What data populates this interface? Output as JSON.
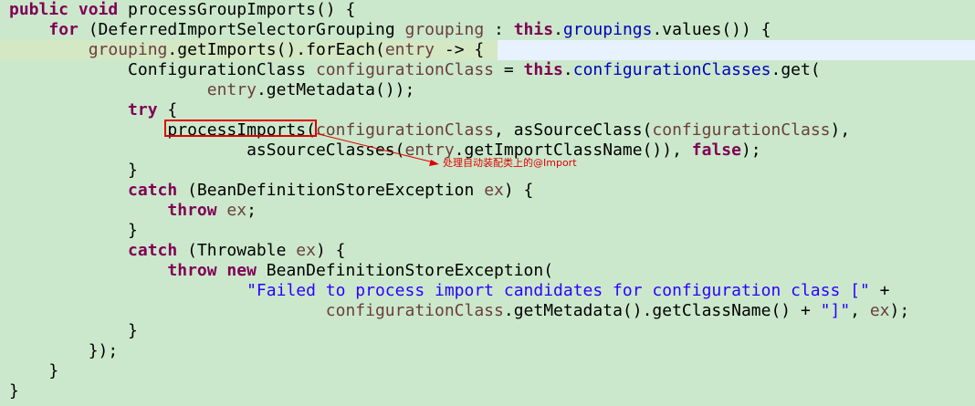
{
  "editor": {
    "lines": [
      [
        {
          "t": "public void",
          "c": "kw"
        },
        {
          "t": " processGroupImports() {",
          "c": "plain"
        }
      ],
      [
        {
          "t": "    ",
          "c": "plain"
        },
        {
          "t": "for",
          "c": "kw"
        },
        {
          "t": " (DeferredImportSelectorGrouping ",
          "c": "plain"
        },
        {
          "t": "grouping",
          "c": "var"
        },
        {
          "t": " : ",
          "c": "plain"
        },
        {
          "t": "this",
          "c": "kw"
        },
        {
          "t": ".",
          "c": "plain"
        },
        {
          "t": "groupings",
          "c": "fld"
        },
        {
          "t": ".values()) {",
          "c": "plain"
        }
      ],
      [
        {
          "t": "        ",
          "c": "plain"
        },
        {
          "t": "grouping",
          "c": "var"
        },
        {
          "t": ".getImports().forEach(",
          "c": "plain"
        },
        {
          "t": "entry",
          "c": "var"
        },
        {
          "t": " -> {",
          "c": "plain"
        }
      ],
      [
        {
          "t": "            ConfigurationClass ",
          "c": "plain"
        },
        {
          "t": "configurationClass",
          "c": "var"
        },
        {
          "t": " = ",
          "c": "plain"
        },
        {
          "t": "this",
          "c": "kw"
        },
        {
          "t": ".",
          "c": "plain"
        },
        {
          "t": "configurationClasses",
          "c": "fld"
        },
        {
          "t": ".get(",
          "c": "plain"
        }
      ],
      [
        {
          "t": "                    ",
          "c": "plain"
        },
        {
          "t": "entry",
          "c": "var"
        },
        {
          "t": ".getMetadata());",
          "c": "plain"
        }
      ],
      [
        {
          "t": "            ",
          "c": "plain"
        },
        {
          "t": "try",
          "c": "kw"
        },
        {
          "t": " {",
          "c": "plain"
        }
      ],
      [
        {
          "t": "                processImports(",
          "c": "plain"
        },
        {
          "t": "configurationClass",
          "c": "var"
        },
        {
          "t": ", asSourceClass(",
          "c": "plain"
        },
        {
          "t": "configurationClass",
          "c": "var"
        },
        {
          "t": "),",
          "c": "plain"
        }
      ],
      [
        {
          "t": "                        asSourceClasses(",
          "c": "plain"
        },
        {
          "t": "entry",
          "c": "var"
        },
        {
          "t": ".getImportClassName()), ",
          "c": "plain"
        },
        {
          "t": "false",
          "c": "kw"
        },
        {
          "t": ");",
          "c": "plain"
        }
      ],
      [
        {
          "t": "            }",
          "c": "plain"
        }
      ],
      [
        {
          "t": "            ",
          "c": "plain"
        },
        {
          "t": "catch",
          "c": "kw"
        },
        {
          "t": " (BeanDefinitionStoreException ",
          "c": "plain"
        },
        {
          "t": "ex",
          "c": "var"
        },
        {
          "t": ") {",
          "c": "plain"
        }
      ],
      [
        {
          "t": "                ",
          "c": "plain"
        },
        {
          "t": "throw",
          "c": "kw"
        },
        {
          "t": " ",
          "c": "plain"
        },
        {
          "t": "ex",
          "c": "var"
        },
        {
          "t": ";",
          "c": "plain"
        }
      ],
      [
        {
          "t": "            }",
          "c": "plain"
        }
      ],
      [
        {
          "t": "            ",
          "c": "plain"
        },
        {
          "t": "catch",
          "c": "kw"
        },
        {
          "t": " (Throwable ",
          "c": "plain"
        },
        {
          "t": "ex",
          "c": "var"
        },
        {
          "t": ") {",
          "c": "plain"
        }
      ],
      [
        {
          "t": "                ",
          "c": "plain"
        },
        {
          "t": "throw new",
          "c": "kw"
        },
        {
          "t": " BeanDefinitionStoreException(",
          "c": "plain"
        }
      ],
      [
        {
          "t": "                        ",
          "c": "plain"
        },
        {
          "t": "\"Failed to process import candidates for configuration class [\"",
          "c": "str"
        },
        {
          "t": " +",
          "c": "plain"
        }
      ],
      [
        {
          "t": "                                ",
          "c": "plain"
        },
        {
          "t": "configurationClass",
          "c": "var"
        },
        {
          "t": ".getMetadata().getClassName() + ",
          "c": "plain"
        },
        {
          "t": "\"]\"",
          "c": "str"
        },
        {
          "t": ", ",
          "c": "plain"
        },
        {
          "t": "ex",
          "c": "var"
        },
        {
          "t": ");",
          "c": "plain"
        }
      ],
      [
        {
          "t": "            }",
          "c": "plain"
        }
      ],
      [
        {
          "t": "        });",
          "c": "plain"
        }
      ],
      [
        {
          "t": "    }",
          "c": "plain"
        }
      ],
      [
        {
          "t": "}",
          "c": "plain"
        }
      ]
    ],
    "current_line_index": 2
  },
  "annotation": {
    "label": "处理自动装配类上的@Import",
    "highlighted_token": "processImports(",
    "color": "#e00000"
  },
  "colors": {
    "background": "#cce8cc",
    "current_line": "#e8f2fe",
    "keyword": "#7f0055",
    "field": "#0000c0",
    "variable": "#6a3e3e",
    "string": "#2a00ff"
  }
}
